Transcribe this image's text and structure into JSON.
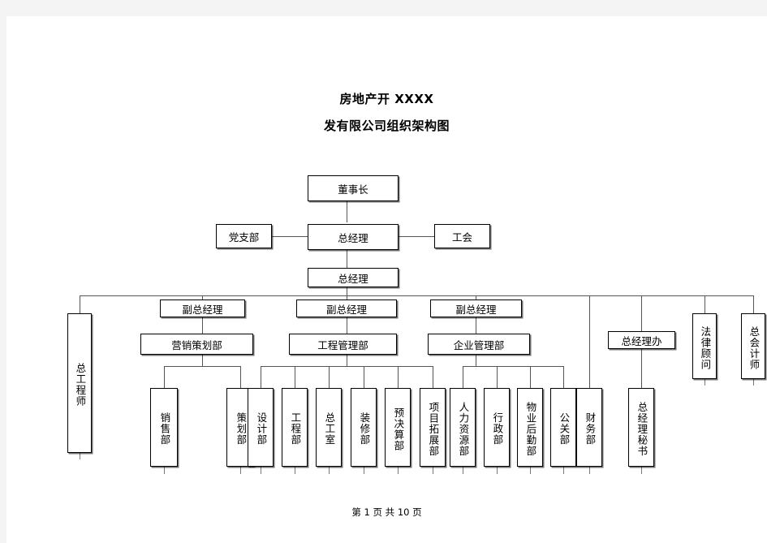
{
  "document": {
    "title_line1": "房地产开 XXXX",
    "title_line2": "发有限公司组织架构图",
    "footer": "第 1 页 共 10 页",
    "page_number": 1,
    "page_total": 10,
    "background_color": "#f4f4f4",
    "sheet_color": "#ffffff",
    "line_color": "#555555",
    "text_color": "#000000"
  },
  "chart_data": {
    "type": "diagram",
    "diagram_kind": "organization-chart",
    "title": "房地产开 XXXX 发有限公司组织架构图",
    "nodes": [
      {
        "id": "chairman",
        "label": "董事长",
        "orientation": "horizontal",
        "level": 0
      },
      {
        "id": "gm1",
        "label": "总经理",
        "orientation": "horizontal",
        "level": 1
      },
      {
        "id": "party_branch",
        "label": "党支部",
        "orientation": "horizontal",
        "level": 1
      },
      {
        "id": "labor_union",
        "label": "工会",
        "orientation": "horizontal",
        "level": 1
      },
      {
        "id": "gm2",
        "label": "总经理",
        "orientation": "horizontal",
        "level": 2
      },
      {
        "id": "chief_engineer",
        "label": "总工程师",
        "orientation": "vertical",
        "level": 3
      },
      {
        "id": "dgm1",
        "label": "副总经理",
        "orientation": "horizontal",
        "level": 3
      },
      {
        "id": "dgm2",
        "label": "副总经理",
        "orientation": "horizontal",
        "level": 3
      },
      {
        "id": "dgm3",
        "label": "副总经理",
        "orientation": "horizontal",
        "level": 3
      },
      {
        "id": "legal_advisor",
        "label": "法律顾问",
        "orientation": "vertical",
        "level": 3
      },
      {
        "id": "chief_accountant",
        "label": "总会计师",
        "orientation": "vertical",
        "level": 3
      },
      {
        "id": "marketing_dept",
        "label": "营销策划部",
        "orientation": "horizontal",
        "level": 4
      },
      {
        "id": "engineering_dept",
        "label": "工程管理部",
        "orientation": "horizontal",
        "level": 4
      },
      {
        "id": "enterprise_dept",
        "label": "企业管理部",
        "orientation": "horizontal",
        "level": 4
      },
      {
        "id": "gm_office",
        "label": "总经理办",
        "orientation": "horizontal",
        "level": 4
      },
      {
        "id": "sales_dept",
        "label": "销售部",
        "orientation": "vertical",
        "level": 5
      },
      {
        "id": "planning_dept",
        "label": "策划部",
        "orientation": "vertical",
        "level": 5
      },
      {
        "id": "design_dept",
        "label": "设计部",
        "orientation": "vertical",
        "level": 5
      },
      {
        "id": "project_dept",
        "label": "工程部",
        "orientation": "vertical",
        "level": 5
      },
      {
        "id": "chief_eng_office",
        "label": "总工室",
        "orientation": "vertical",
        "level": 5
      },
      {
        "id": "decoration_dept",
        "label": "装修部",
        "orientation": "vertical",
        "level": 5
      },
      {
        "id": "budget_dept",
        "label": "预决算部",
        "orientation": "vertical",
        "level": 5
      },
      {
        "id": "expansion_dept",
        "label": "项目拓展部",
        "orientation": "vertical",
        "level": 5
      },
      {
        "id": "hr_dept",
        "label": "人力资源部",
        "orientation": "vertical",
        "level": 5
      },
      {
        "id": "admin_dept",
        "label": "行政部",
        "orientation": "vertical",
        "level": 5
      },
      {
        "id": "property_dept",
        "label": "物业后勤部",
        "orientation": "vertical",
        "level": 5
      },
      {
        "id": "pr_dept",
        "label": "公关部",
        "orientation": "vertical",
        "level": 5
      },
      {
        "id": "finance_dept",
        "label": "财务部",
        "orientation": "vertical",
        "level": 5
      },
      {
        "id": "gm_secretary",
        "label": "总经理秘书",
        "orientation": "vertical",
        "level": 5
      }
    ],
    "edges": [
      {
        "from": "chairman",
        "to": "gm1"
      },
      {
        "from": "party_branch",
        "to": "gm1"
      },
      {
        "from": "gm1",
        "to": "labor_union"
      },
      {
        "from": "gm1",
        "to": "gm2"
      },
      {
        "from": "gm2",
        "to": "chief_engineer"
      },
      {
        "from": "gm2",
        "to": "dgm1"
      },
      {
        "from": "gm2",
        "to": "dgm2"
      },
      {
        "from": "gm2",
        "to": "dgm3"
      },
      {
        "from": "gm2",
        "to": "legal_advisor"
      },
      {
        "from": "gm2",
        "to": "chief_accountant"
      },
      {
        "from": "gm2",
        "to": "gm_office"
      },
      {
        "from": "gm2",
        "to": "finance_dept"
      },
      {
        "from": "gm2",
        "to": "gm_secretary"
      },
      {
        "from": "dgm1",
        "to": "marketing_dept"
      },
      {
        "from": "dgm2",
        "to": "engineering_dept"
      },
      {
        "from": "dgm3",
        "to": "enterprise_dept"
      },
      {
        "from": "marketing_dept",
        "to": "sales_dept"
      },
      {
        "from": "marketing_dept",
        "to": "planning_dept"
      },
      {
        "from": "engineering_dept",
        "to": "design_dept"
      },
      {
        "from": "engineering_dept",
        "to": "project_dept"
      },
      {
        "from": "engineering_dept",
        "to": "chief_eng_office"
      },
      {
        "from": "engineering_dept",
        "to": "decoration_dept"
      },
      {
        "from": "engineering_dept",
        "to": "budget_dept"
      },
      {
        "from": "engineering_dept",
        "to": "expansion_dept"
      },
      {
        "from": "enterprise_dept",
        "to": "hr_dept"
      },
      {
        "from": "enterprise_dept",
        "to": "admin_dept"
      },
      {
        "from": "enterprise_dept",
        "to": "property_dept"
      },
      {
        "from": "enterprise_dept",
        "to": "pr_dept"
      }
    ]
  }
}
